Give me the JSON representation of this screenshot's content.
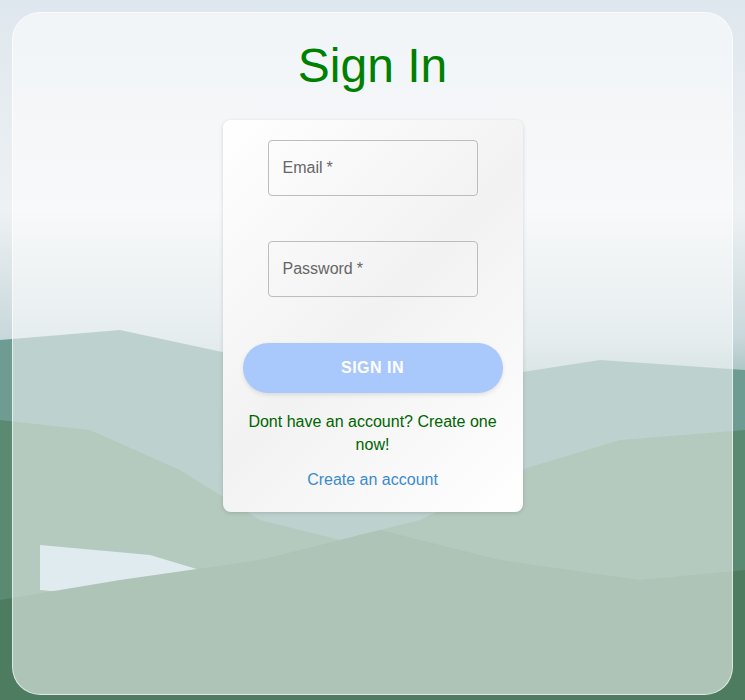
{
  "title": "Sign In",
  "fields": [
    {
      "label": "Email",
      "required_mark": "*"
    },
    {
      "label": "Password",
      "required_mark": "*"
    }
  ],
  "submit": {
    "label": "SIGN IN",
    "disabled": true
  },
  "prompt": "Dont have an account? Create one now!",
  "link": "Create an account"
}
